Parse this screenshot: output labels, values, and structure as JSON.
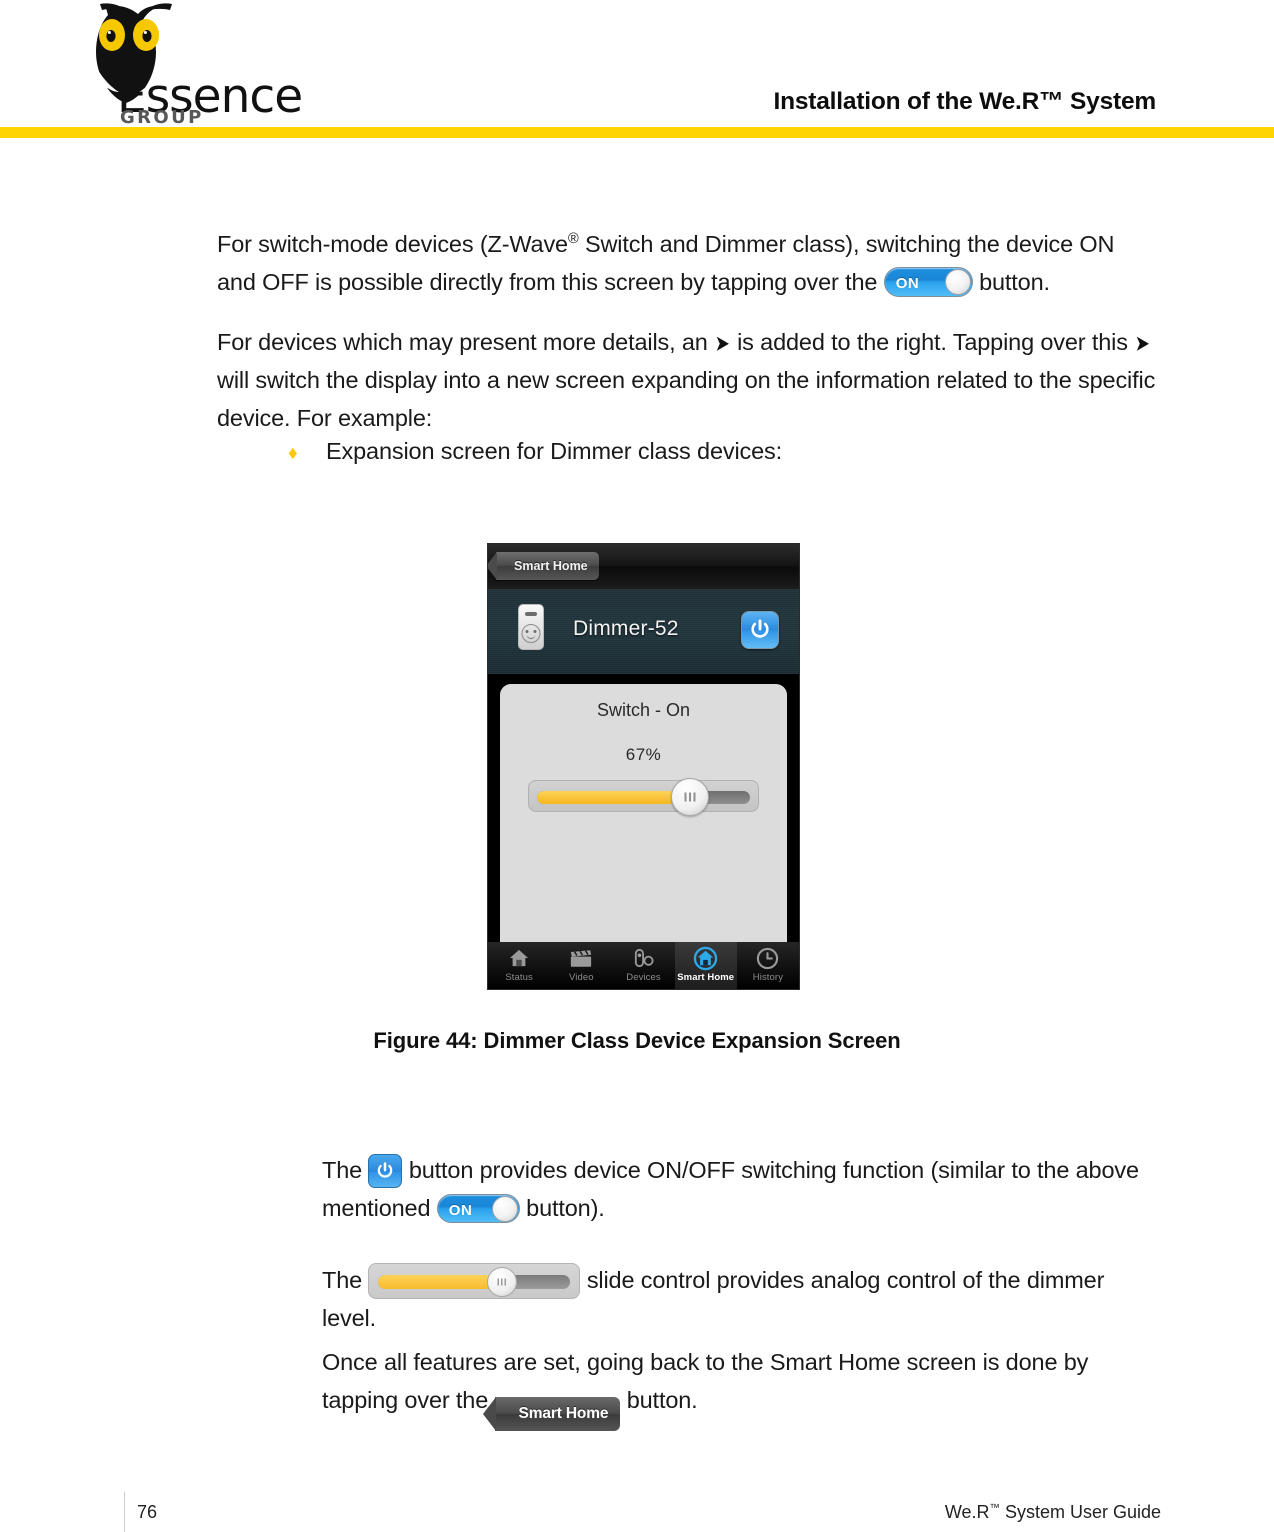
{
  "header": {
    "title": "Installation of the We.R™ System",
    "logo_wordmark": "Essence",
    "logo_sub": "GROUP",
    "accent_color": "#FFD400"
  },
  "body": {
    "p1_a": "For switch-mode devices (Z-Wave",
    "p1_reg": "®",
    "p1_b": " Switch and Dimmer class), switching the device ON and OFF is possible directly from this screen by tapping over the ",
    "p1_c": " button.",
    "p2_a": "For devices which may present more details, an ",
    "p2_arrow": "➤",
    "p2_b": " is added to the right. Tapping over this ",
    "p2_c": " will switch the display into a new screen expanding on the information related to the specific device. For example:",
    "bullet_marker": "♦",
    "bullet_text": "Expansion screen for Dimmer class devices:",
    "p3_a": "The ",
    "p3_b": " button provides device ON/OFF switching function (similar to the above mentioned ",
    "p3_c": " button).",
    "p4_a": "The ",
    "p4_b": " slide control provides analog control of the dimmer level.",
    "p5_a": "Once all features are set, going back to the Smart Home screen is done by tapping over the ",
    "p5_b": " button."
  },
  "toggle": {
    "label": "ON"
  },
  "phone": {
    "back_button": "Smart Home",
    "device_name": "Dimmer-52",
    "panel_title": "Switch - On",
    "panel_percent": "67%",
    "slider_value": 67,
    "tabs": [
      {
        "label": "Status",
        "icon": "home-icon",
        "active": false
      },
      {
        "label": "Video",
        "icon": "clapper-icon",
        "active": false
      },
      {
        "label": "Devices",
        "icon": "sensors-icon",
        "active": false
      },
      {
        "label": "Smart Home",
        "icon": "smarthome-icon",
        "active": true
      },
      {
        "label": "History",
        "icon": "clock-icon",
        "active": false
      }
    ]
  },
  "figure": {
    "caption": "Figure 44: Dimmer Class Device Expansion Screen"
  },
  "footer": {
    "page_number": "76",
    "guide_a": "We.R",
    "guide_tm": "™",
    "guide_b": " System User Guide"
  }
}
